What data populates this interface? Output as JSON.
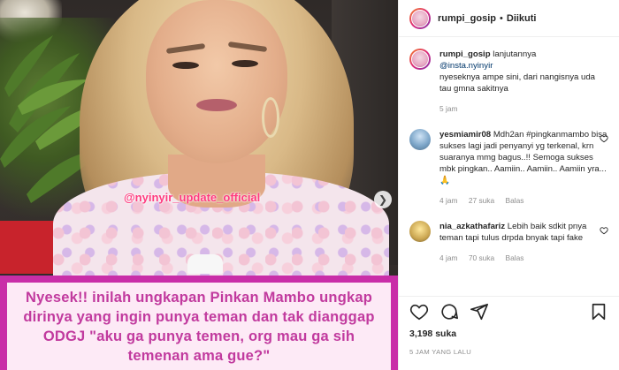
{
  "post": {
    "author": "rumpi_gosip",
    "follow_status": "Diikuti",
    "watermark": "@nyinyir_update_official",
    "caption": "Nyesek!! inilah ungkapan Pinkan Mambo ungkap dirinya yang ingin punya teman dan tak dianggap ODGJ \"aku ga punya temen, org mau ga sih temenan ama gue?\"",
    "likes": "3,198 suka",
    "posted": "5 JAM YANG LALU"
  },
  "comments": [
    {
      "user": "rumpi_gosip",
      "text_before": "lanjutannya",
      "mention": "@insta.nyinyir",
      "text_after": "nyeseknya ampe sini, dari nangisnya uda tau gmna sakitnya",
      "time": "5 jam"
    },
    {
      "user": "yesmiamir08",
      "text": "Mdh2an #pingkanmambo bisa sukses lagi jadi penyanyi yg terkenal, krn suaranya mmg bagus..!! Semoga sukses mbk pingkan.. Aamiin.. Aamiin.. Aamiin yra...🙏",
      "time": "4 jam",
      "likes": "27 suka",
      "reply": "Balas"
    },
    {
      "user": "nia_azkathafariz",
      "text": "Lebih baik sdkit pnya teman tapi tulus drpda bnyak tapi fake",
      "time": "4 jam",
      "likes": "70 suka",
      "reply": "Balas"
    }
  ],
  "icons": {
    "like": "heart-icon",
    "comment": "comment-icon",
    "share": "share-icon",
    "save": "bookmark-icon",
    "next": "chevron-right-icon"
  },
  "colors": {
    "caption_border": "#c92ea8",
    "caption_bg": "#fdeaf6",
    "caption_text": "#c13a9e",
    "watermark": "#ff3b7f"
  }
}
